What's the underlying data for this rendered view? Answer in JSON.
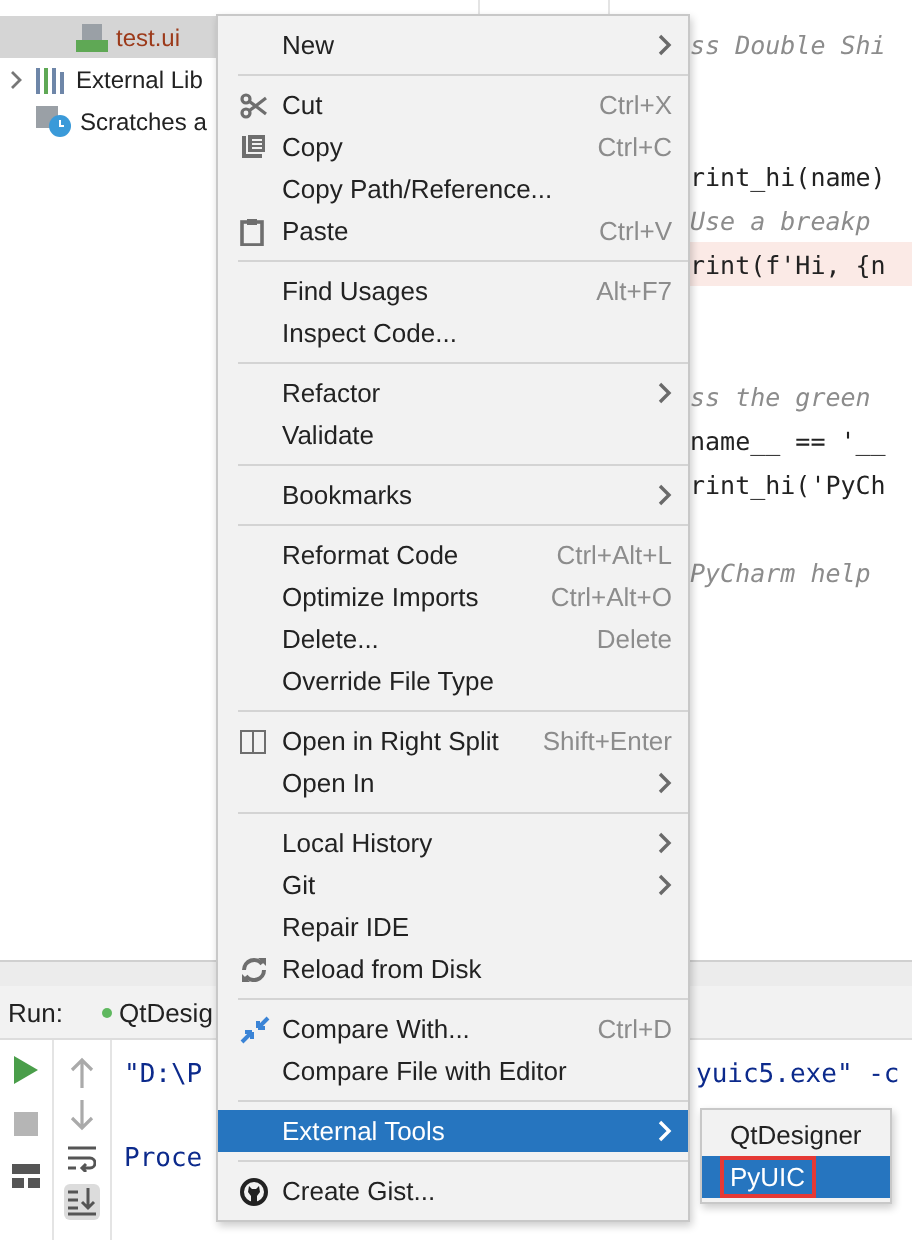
{
  "project_tree": [
    {
      "label": "test.ui",
      "kind": "file",
      "selected": true,
      "expandable": false
    },
    {
      "label": "External Lib",
      "kind": "library",
      "selected": false,
      "expandable": true
    },
    {
      "label": "Scratches a",
      "kind": "scratches",
      "selected": false,
      "expandable": false
    }
  ],
  "editor": {
    "lines": [
      {
        "text": "ss Double Shi",
        "kind": "comment",
        "highlighted": false
      },
      {
        "kind": "blank"
      },
      {
        "kind": "blank"
      },
      {
        "text": "rint_hi(name)",
        "kind": "code",
        "highlighted": false
      },
      {
        "text": "Use a breakp",
        "kind": "comment",
        "highlighted": false
      },
      {
        "text": "rint(f'Hi, {n",
        "kind": "code",
        "highlighted": true
      },
      {
        "kind": "blank"
      },
      {
        "kind": "blank"
      },
      {
        "text": "ss the green",
        "kind": "comment",
        "highlighted": false
      },
      {
        "text": "name__ == '__",
        "kind": "code",
        "highlighted": false
      },
      {
        "text": "rint_hi('PyCh",
        "kind": "code",
        "highlighted": false
      },
      {
        "kind": "blank"
      },
      {
        "text": "PyCharm help",
        "kind": "comment",
        "highlighted": false
      }
    ]
  },
  "run_panel": {
    "label": "Run:",
    "tab": "QtDesig",
    "console": [
      {
        "left": "\"D:\\P",
        "right": "yuic5.exe\" -c"
      },
      {
        "left": "Proce"
      }
    ]
  },
  "context_menu": {
    "items": [
      {
        "kind": "item",
        "label": "New",
        "submenu": true,
        "selected": false
      },
      {
        "kind": "separator"
      },
      {
        "kind": "item",
        "label": "Cut",
        "shortcut": "Ctrl+X",
        "submenu": false,
        "selected": false
      },
      {
        "kind": "item",
        "label": "Copy",
        "shortcut": "Ctrl+C",
        "submenu": false,
        "selected": false
      },
      {
        "kind": "item",
        "label": "Copy Path/Reference...",
        "submenu": false,
        "selected": false
      },
      {
        "kind": "item",
        "label": "Paste",
        "shortcut": "Ctrl+V",
        "submenu": false,
        "selected": false
      },
      {
        "kind": "separator"
      },
      {
        "kind": "item",
        "label": "Find Usages",
        "shortcut": "Alt+F7",
        "submenu": false,
        "selected": false
      },
      {
        "kind": "item",
        "label": "Inspect Code...",
        "submenu": false,
        "selected": false
      },
      {
        "kind": "separator"
      },
      {
        "kind": "item",
        "label": "Refactor",
        "submenu": true,
        "selected": false
      },
      {
        "kind": "item",
        "label": "Validate",
        "submenu": false,
        "selected": false
      },
      {
        "kind": "separator"
      },
      {
        "kind": "item",
        "label": "Bookmarks",
        "submenu": true,
        "selected": false
      },
      {
        "kind": "separator"
      },
      {
        "kind": "item",
        "label": "Reformat Code",
        "shortcut": "Ctrl+Alt+L",
        "submenu": false,
        "selected": false
      },
      {
        "kind": "item",
        "label": "Optimize Imports",
        "shortcut": "Ctrl+Alt+O",
        "submenu": false,
        "selected": false
      },
      {
        "kind": "item",
        "label": "Delete...",
        "shortcut": "Delete",
        "submenu": false,
        "selected": false
      },
      {
        "kind": "item",
        "label": "Override File Type",
        "submenu": false,
        "selected": false
      },
      {
        "kind": "separator"
      },
      {
        "kind": "item",
        "label": "Open in Right Split",
        "shortcut": "Shift+Enter",
        "submenu": false,
        "selected": false
      },
      {
        "kind": "item",
        "label": "Open In",
        "submenu": true,
        "selected": false
      },
      {
        "kind": "separator"
      },
      {
        "kind": "item",
        "label": "Local History",
        "submenu": true,
        "selected": false
      },
      {
        "kind": "item",
        "label": "Git",
        "submenu": true,
        "selected": false
      },
      {
        "kind": "item",
        "label": "Repair IDE",
        "submenu": false,
        "selected": false
      },
      {
        "kind": "item",
        "label": "Reload from Disk",
        "submenu": false,
        "selected": false
      },
      {
        "kind": "separator"
      },
      {
        "kind": "item",
        "label": "Compare With...",
        "shortcut": "Ctrl+D",
        "submenu": false,
        "selected": false
      },
      {
        "kind": "item",
        "label": "Compare File with Editor",
        "submenu": false,
        "selected": false
      },
      {
        "kind": "separator"
      },
      {
        "kind": "item",
        "label": "External Tools",
        "submenu": true,
        "selected": true
      },
      {
        "kind": "separator"
      },
      {
        "kind": "item",
        "label": "Create Gist...",
        "submenu": false,
        "selected": false
      }
    ]
  },
  "submenu": {
    "items": [
      {
        "label": "QtDesigner",
        "selected": false,
        "annotated": false
      },
      {
        "label": "PyUIC",
        "selected": true,
        "annotated": true
      }
    ]
  }
}
